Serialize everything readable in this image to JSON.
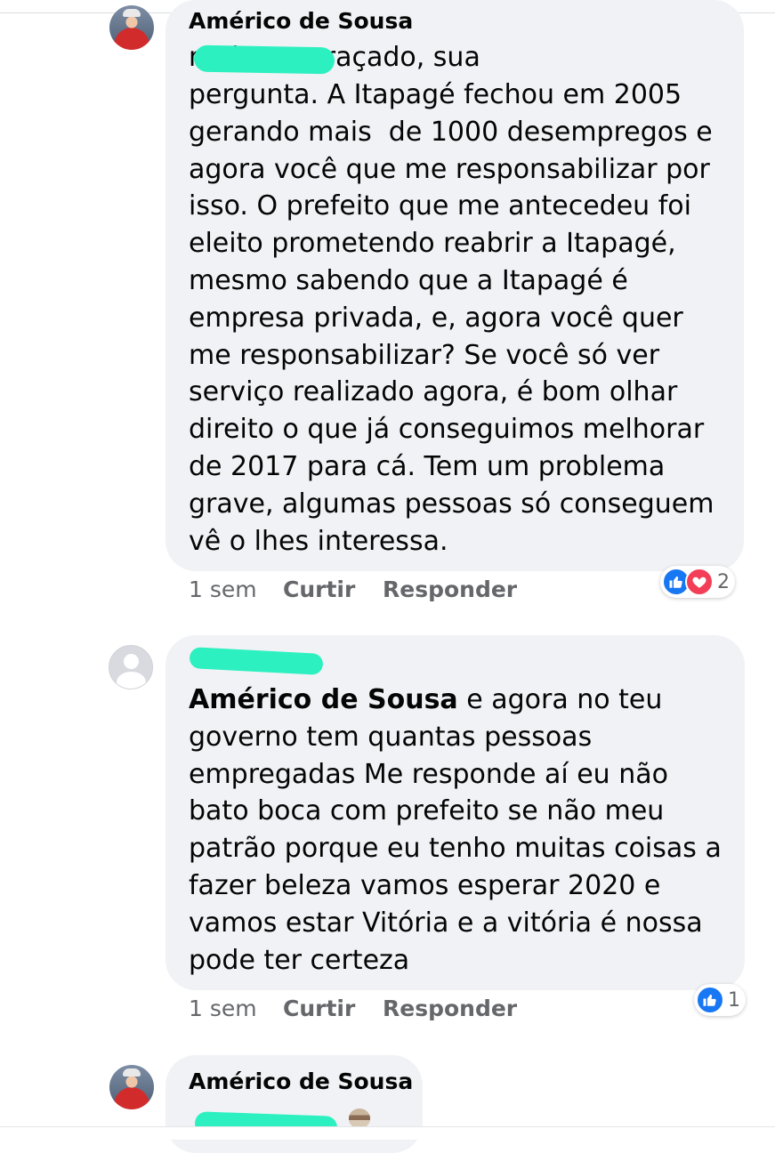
{
  "comments": [
    {
      "author": "Américo de Sousa",
      "text_fragment": "muito engraçado, sua",
      "text_body": "pergunta. A Itapagé fechou em 2005\ngerando mais  de 1000 desempregos e\nagora você que me responsabilizar por\nisso. O prefeito que me antecedeu foi\neleito prometendo reabrir a Itapagé,\nmesmo sabendo que a Itapagé é\nempresa privada, e, agora você quer\nme responsabilizar? Se você só ver\nserviço realizado agora, é bom olhar\ndireito o que já conseguimos melhorar\nde 2017 para cá. Tem um problema\ngrave, algumas pessoas só conseguem\nvê o lhes interessa.",
      "time": "1 sem",
      "like_label": "Curtir",
      "reply_label": "Responder",
      "reaction_count": "2",
      "reactions": [
        "like-icon",
        "heart-icon"
      ]
    },
    {
      "author": "",
      "mention": "Américo de Sousa",
      "text": " e agora no teu\ngoverno tem quantas pessoas\nempregadas Me responde aí eu não\nbato boca com prefeito se não meu\npatrão porque eu tenho muitas coisas a\nfazer beleza vamos esperar 2020 e\nvamos estar Vitória e a vitória é nossa\npode ter certeza",
      "time": "1 sem",
      "like_label": "Curtir",
      "reply_label": "Responder",
      "reaction_count": "1",
      "reactions": [
        "like-icon"
      ]
    },
    {
      "author": "Américo de Sousa"
    }
  ],
  "colors": {
    "bubble": "#f0f2f5",
    "meta": "#65676b",
    "like": "#1877f2",
    "love": "#f33e58",
    "redaction": "#2df0c0"
  }
}
